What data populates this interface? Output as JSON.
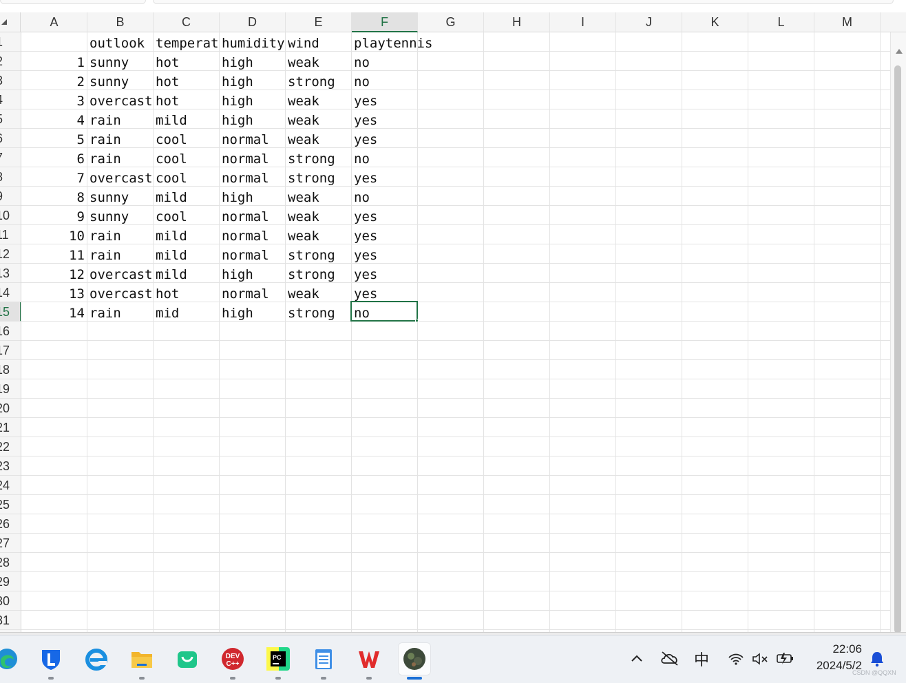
{
  "columns": [
    "A",
    "B",
    "C",
    "D",
    "E",
    "F",
    "G",
    "H",
    "I",
    "J",
    "K",
    "L",
    "M"
  ],
  "selected_column": "F",
  "rows": [
    "1",
    "2",
    "3",
    "4",
    "5",
    "6",
    "7",
    "8",
    "9",
    "10",
    "11",
    "12",
    "13",
    "14",
    "15",
    "16",
    "17",
    "18",
    "19",
    "20",
    "21",
    "22",
    "23",
    "24",
    "25",
    "26",
    "27",
    "28",
    "29",
    "30",
    "31"
  ],
  "selected_row": "15",
  "sheet": {
    "headers": [
      "",
      "outlook",
      "temperature",
      "humidity",
      "wind",
      "playtennis"
    ],
    "records": [
      [
        "1",
        "sunny",
        "hot",
        "high",
        "weak",
        "no"
      ],
      [
        "2",
        "sunny",
        "hot",
        "high",
        "strong",
        "no"
      ],
      [
        "3",
        "overcast",
        "hot",
        "high",
        "weak",
        "yes"
      ],
      [
        "4",
        "rain",
        "mild",
        "high",
        "weak",
        "yes"
      ],
      [
        "5",
        "rain",
        "cool",
        "normal",
        "weak",
        "yes"
      ],
      [
        "6",
        "rain",
        "cool",
        "normal",
        "strong",
        "no"
      ],
      [
        "7",
        "overcast",
        "cool",
        "normal",
        "strong",
        "yes"
      ],
      [
        "8",
        "sunny",
        "mild",
        "high",
        "weak",
        "no"
      ],
      [
        "9",
        "sunny",
        "cool",
        "normal",
        "weak",
        "yes"
      ],
      [
        "10",
        "rain",
        "mild",
        "normal",
        "weak",
        "yes"
      ],
      [
        "11",
        "rain",
        "mild",
        "normal",
        "strong",
        "yes"
      ],
      [
        "12",
        "overcast",
        "mild",
        "high",
        "strong",
        "yes"
      ],
      [
        "13",
        "overcast",
        "hot",
        "normal",
        "weak",
        "yes"
      ],
      [
        "14",
        "rain",
        "mid",
        "high",
        "strong",
        "no"
      ]
    ]
  },
  "taskbar": {
    "apps": [
      {
        "name": "edge-browser-icon"
      },
      {
        "name": "security-shield-icon"
      },
      {
        "name": "ie-browser-icon"
      },
      {
        "name": "file-explorer-icon"
      },
      {
        "name": "shopping-bag-icon"
      },
      {
        "name": "dev-cpp-icon",
        "label": "DEV C++"
      },
      {
        "name": "pycharm-icon",
        "label": "PC"
      },
      {
        "name": "notepad-icon"
      },
      {
        "name": "wps-office-icon",
        "label": "W"
      },
      {
        "name": "avatar-app-icon"
      }
    ],
    "tray": {
      "ime_label": "中",
      "time": "22:06",
      "date": "2024/5/2"
    },
    "watermark": "CSDN @QQXN"
  },
  "colors": {
    "accent": "#217346",
    "taskbar_bg": "#eef1f5"
  }
}
